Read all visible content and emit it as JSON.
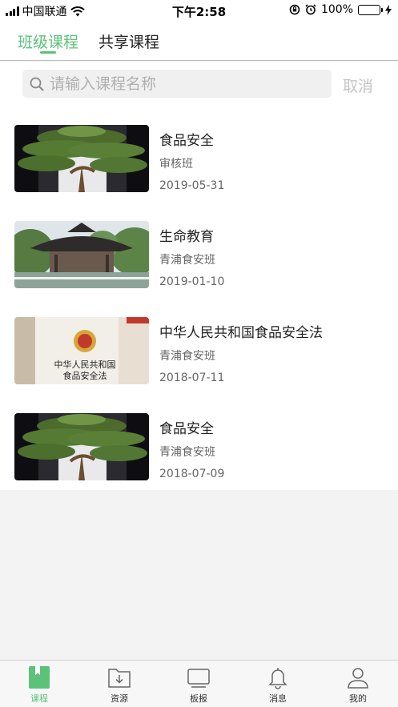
{
  "status_bar": {
    "carrier": "中国联通",
    "time": "下午2:58",
    "battery": "100%"
  },
  "top_tabs": [
    {
      "label": "班级课程",
      "active": true
    },
    {
      "label": "共享课程",
      "active": false
    }
  ],
  "search": {
    "placeholder": "请输入课程名称",
    "value": "",
    "cancel_label": "取消"
  },
  "courses": [
    {
      "title": "食品安全",
      "class": "审核班",
      "date": "2019-05-31",
      "thumbnail": "bonsai-pine-image"
    },
    {
      "title": "生命教育",
      "class": "青浦食安班",
      "date": "2019-01-10",
      "thumbnail": "pavilion-image"
    },
    {
      "title": "中华人民共和国食品安全法",
      "class": "青浦食安班",
      "date": "2018-07-11",
      "thumbnail": "law-book-cover-image"
    },
    {
      "title": "食品安全",
      "class": "青浦食安班",
      "date": "2018-07-09",
      "thumbnail": "bonsai-pine-image"
    }
  ],
  "thumbnail_text": {
    "law_book_line1": "中华人民共和国",
    "law_book_line2": "食品安全法"
  },
  "bottom_tabs": [
    {
      "label": "课程",
      "icon": "book-icon",
      "active": true
    },
    {
      "label": "资源",
      "icon": "folder-download-icon",
      "active": false
    },
    {
      "label": "板报",
      "icon": "board-icon",
      "active": false
    },
    {
      "label": "消息",
      "icon": "bell-icon",
      "active": false
    },
    {
      "label": "我的",
      "icon": "person-icon",
      "active": false
    }
  ],
  "colors": {
    "accent": "#5cc27a",
    "inactive_text": "#333333",
    "background": "#f3f3f3"
  }
}
